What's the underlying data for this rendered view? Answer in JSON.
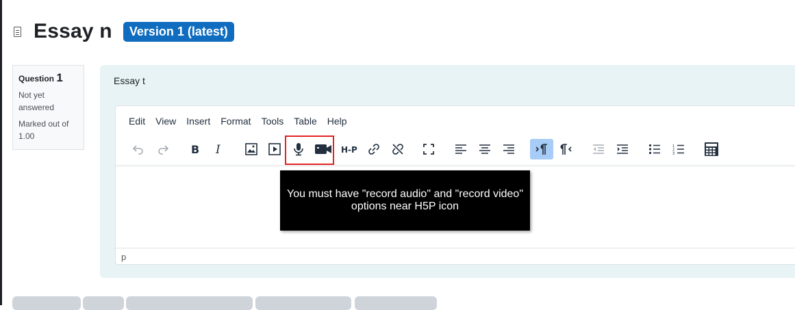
{
  "page": {
    "title": "Essay n",
    "version_badge": "Version 1 (latest)"
  },
  "question_info": {
    "label": "Question",
    "number": "1",
    "state": "Not yet answered",
    "grade": "Marked out of 1.00"
  },
  "question": {
    "text": "Essay t"
  },
  "editor": {
    "menu": [
      "Edit",
      "View",
      "Insert",
      "Format",
      "Tools",
      "Table",
      "Help"
    ],
    "toolbar_icons": [
      "undo-icon",
      "redo-icon",
      "bold-icon",
      "italic-icon",
      "image-icon",
      "media-icon",
      "record-audio-icon",
      "record-video-icon",
      "h5p-icon",
      "link-icon",
      "unlink-icon",
      "fullscreen-icon",
      "align-left-icon",
      "align-center-icon",
      "align-right-icon",
      "ltr-icon",
      "rtl-icon",
      "outdent-icon",
      "indent-icon",
      "bullet-list-icon",
      "numbered-list-icon",
      "calculator-icon"
    ],
    "h5p_label": "H-P",
    "status_path": "p"
  },
  "callout": {
    "line1": "You must have \"record audio\" and \"record video\"",
    "line2": "options near H5P icon"
  },
  "colors": {
    "badge": "#0f6cbf",
    "highlight": "#e32222",
    "content_bg": "#e7f3f5"
  }
}
